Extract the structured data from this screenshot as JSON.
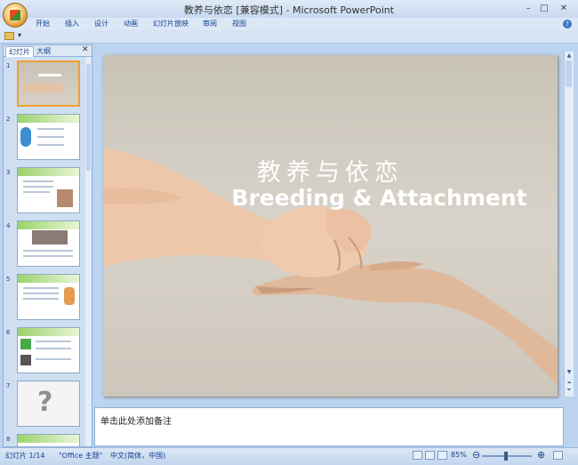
{
  "window": {
    "title": "教养与依恋 [兼容模式] - Microsoft PowerPoint",
    "minimize": "–",
    "maximize": "□",
    "close": "✕"
  },
  "ribbon": {
    "tabs": [
      "开始",
      "插入",
      "设计",
      "动画",
      "幻灯片放映",
      "审阅",
      "视图"
    ],
    "help": "?"
  },
  "qat": {
    "dropdown": "▾"
  },
  "left_pane": {
    "tabs": {
      "slides": "幻灯片",
      "outline": "大纲"
    },
    "close": "✕",
    "slide_numbers": [
      "1",
      "2",
      "3",
      "4",
      "5",
      "6",
      "7",
      "8"
    ]
  },
  "slide": {
    "title_cn": "教养与依恋",
    "title_en": "Breeding & Attachment"
  },
  "notes": {
    "placeholder": "单击此处添加备注"
  },
  "status": {
    "slide_info": "幻灯片 1/14",
    "theme": "\"Office 主题\"",
    "language": "中文(简体，中国)",
    "zoom": "85%"
  },
  "colors": {
    "accent": "#15428b",
    "selection": "#f0a030"
  }
}
